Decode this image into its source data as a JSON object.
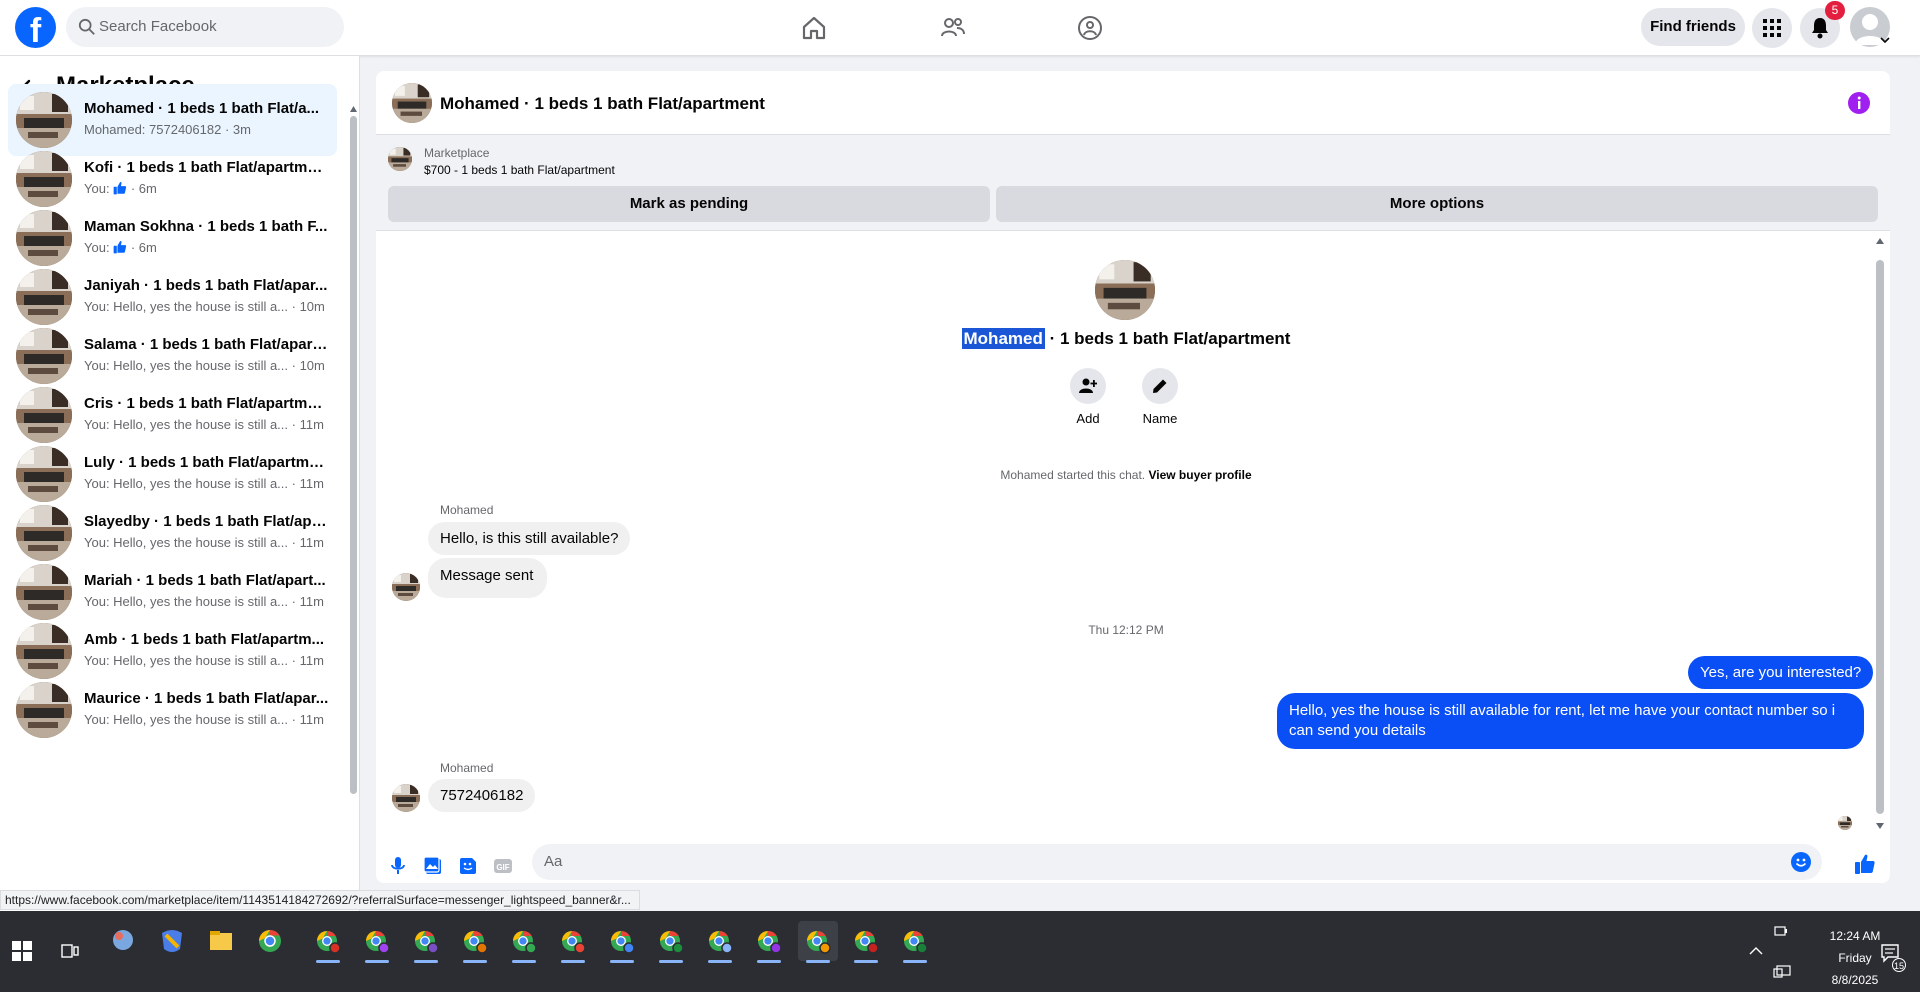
{
  "topbar": {
    "search_placeholder": "Search Facebook",
    "find_friends_label": "Find friends",
    "notification_count": "5"
  },
  "sidebar": {
    "title": "Marketplace",
    "conversations": [
      {
        "name": "Mohamed · 1 beds 1 bath Flat/a...",
        "preview": "Mohamed: 7572406182 · 3m",
        "active": true
      },
      {
        "name": "Kofi · 1 beds 1 bath Flat/apartment",
        "preview_prefix": "You:",
        "preview_time": "· 6m"
      },
      {
        "name": "Maman Sokhna · 1 beds 1 bath F...",
        "preview_prefix": "You:",
        "preview_time": "· 6m"
      },
      {
        "name": "Janiyah · 1 beds 1 bath Flat/apar...",
        "preview": "You: Hello, yes the house is still a... · 10m"
      },
      {
        "name": "Salama · 1 beds 1 bath Flat/apart...",
        "preview": "You: Hello, yes the house is still a... · 10m"
      },
      {
        "name": "Cris · 1 beds 1 bath Flat/apartment",
        "preview": "You: Hello, yes the house is still a... · 11m"
      },
      {
        "name": "Luly · 1 beds 1 bath Flat/apartme...",
        "preview": "You: Hello, yes the house is still a... · 11m"
      },
      {
        "name": "Slayedby · 1 beds 1 bath Flat/apa...",
        "preview": "You: Hello, yes the house is still a... · 11m"
      },
      {
        "name": "Mariah · 1 beds 1 bath Flat/apart...",
        "preview": "You: Hello, yes the house is still a... · 11m"
      },
      {
        "name": "Amb · 1 beds 1 bath Flat/apartm...",
        "preview": "You: Hello, yes the house is still a... · 11m"
      },
      {
        "name": "Maurice · 1 beds 1 bath Flat/apar...",
        "preview": "You: Hello, yes the house is still a... · 11m"
      }
    ]
  },
  "chat": {
    "header_title": "Mohamed · 1 beds 1 bath Flat/apartment",
    "marketplace_label": "Marketplace",
    "listing_price_title": "$700 - 1 beds 1 bath Flat/apartment",
    "mark_pending_label": "Mark as pending",
    "more_options_label": "More options",
    "center_name_highlight": "Mohamed",
    "center_title_rest": " · 1 beds 1 bath Flat/apartment",
    "add_label": "Add",
    "name_label": "Name",
    "started_text": "Mohamed started this chat.",
    "view_buyer_profile": "View buyer profile",
    "messages": {
      "sender1": "Mohamed",
      "msg1": "Hello, is this still available?",
      "msg2": "Message sent",
      "timestamp": "Thu 12:12 PM",
      "out1": "Yes, are you interested?",
      "out2": "Hello, yes the house is still available for rent, let me have your contact number so i can send you details",
      "sender2": "Mohamed",
      "msg3": "7572406182"
    },
    "composer_placeholder": "Aa"
  },
  "statusbar": {
    "url": "https://www.facebook.com/marketplace/item/1143514184272692/?referralSurface=messenger_lightspeed_banner&r..."
  },
  "taskbar": {
    "time": "12:24 AM",
    "day": "Friday",
    "date": "8/8/2025",
    "notification_count": "15"
  },
  "colors": {
    "brand": "#0866ff",
    "outgoing_bubble": "#0a4ff5",
    "badge": "#e41e3f",
    "info_icon": "#a020f0"
  }
}
